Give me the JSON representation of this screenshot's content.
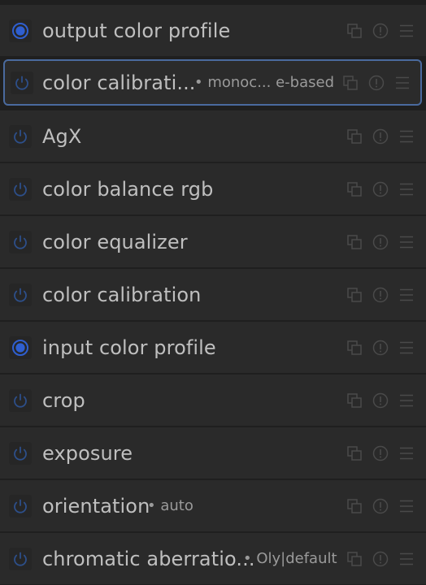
{
  "modules": [
    {
      "name": "output color profile",
      "label": "",
      "enabled": true
    },
    {
      "name": "color calibrati...",
      "label": "• monoc... e-based",
      "enabled": false,
      "focused": true
    },
    {
      "name": "AgX",
      "label": "",
      "enabled": false
    },
    {
      "name": "color balance rgb",
      "label": "",
      "enabled": false
    },
    {
      "name": "color equalizer",
      "label": "",
      "enabled": false
    },
    {
      "name": "color calibration",
      "label": "",
      "enabled": false
    },
    {
      "name": "input color profile",
      "label": "",
      "enabled": true
    },
    {
      "name": "crop",
      "label": "",
      "enabled": false
    },
    {
      "name": "exposure",
      "label": "",
      "enabled": false
    },
    {
      "name": "orientation",
      "label": "• auto",
      "enabled": false
    },
    {
      "name": "chromatic aberratio...",
      "label": "• Oly|default",
      "enabled": false
    }
  ],
  "icons": {
    "power_on": "power-on-icon",
    "power_off": "power-icon",
    "presets": "presets-icon",
    "reset": "reset-icon",
    "menu": "hamburger-menu-icon"
  },
  "colors": {
    "accent": "#2f5fd0",
    "power_off": "#2d4f8a",
    "text": "#bfbfbf",
    "icon": "#4a4a4a",
    "focus_border": "#4a6a9e"
  }
}
